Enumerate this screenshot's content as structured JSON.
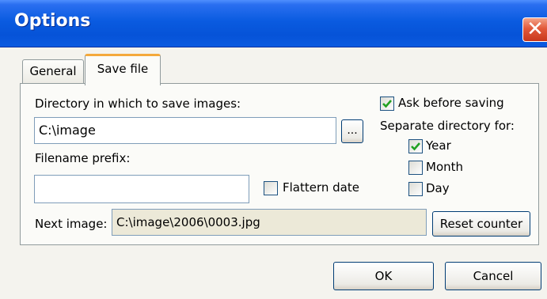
{
  "window": {
    "title": "Options",
    "close_label": "✕"
  },
  "tabs": [
    {
      "label": "General",
      "active": false
    },
    {
      "label": "Save file",
      "active": true
    }
  ],
  "save_file": {
    "directory_label": "Directory in which to save images:",
    "directory_value": "C:\\image",
    "browse_label": "...",
    "filename_prefix_label": "Filename prefix:",
    "filename_prefix_value": "",
    "flatten_date_label": "Flattern date",
    "flatten_date_checked": false,
    "ask_before_saving_label": "Ask before saving",
    "ask_before_saving_checked": true,
    "separate_dir_label": "Separate directory for:",
    "year_label": "Year",
    "year_checked": true,
    "month_label": "Month",
    "month_checked": false,
    "day_label": "Day",
    "day_checked": false,
    "next_image_label": "Next image:",
    "next_image_value": "C:\\image\\2006\\0003.jpg",
    "reset_counter_label": "Reset counter"
  },
  "footer": {
    "ok_label": "OK",
    "cancel_label": "Cancel"
  },
  "colors": {
    "titlebar": "#0a5be0",
    "close": "#e2593a",
    "dialog_bg": "#ece9d8",
    "tab_accent": "#f4a93c",
    "check": "#21a121"
  }
}
